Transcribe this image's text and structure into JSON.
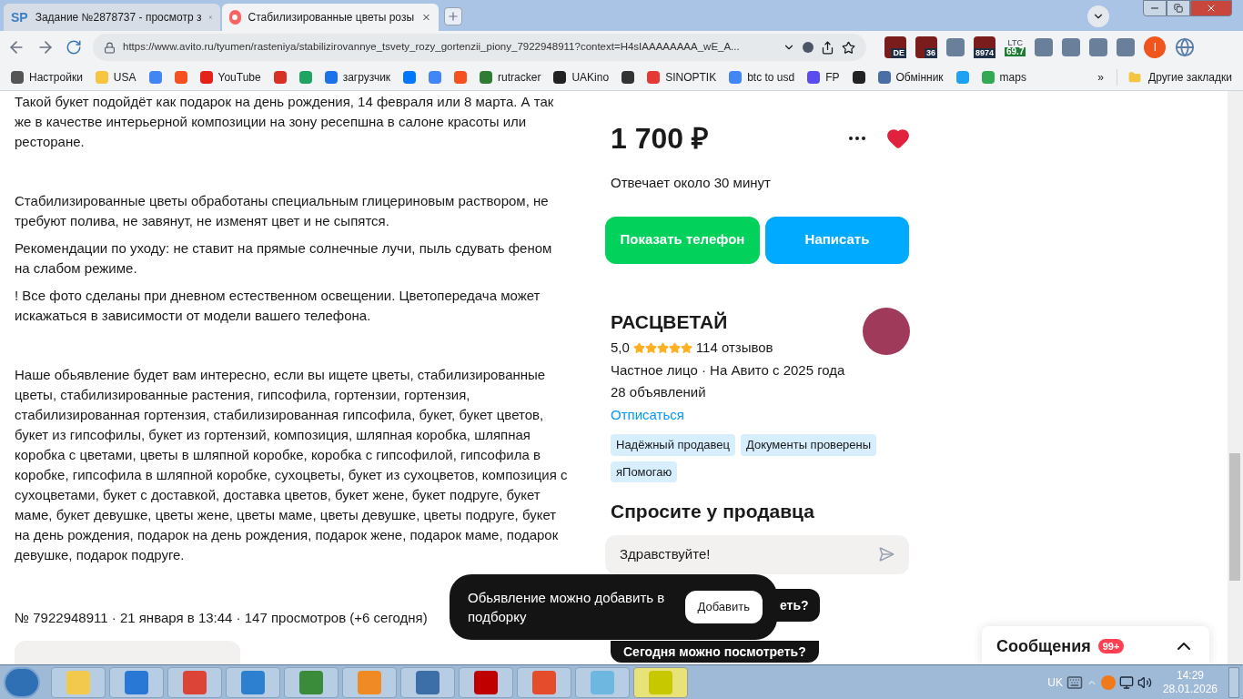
{
  "browser": {
    "tabs": [
      {
        "title": "Задание №2878737 - просмотр з",
        "selected": false,
        "favicon": "SP"
      },
      {
        "title": "Стабилизированные цветы розы",
        "selected": true
      }
    ],
    "url": "https://www.avito.ru/tyumen/rasteniya/stabilizirovannye_tsvety_rozy_gortenzii_piony_7922948911?context=H4sIAAAAAAAA_wE_A...",
    "extensions": [
      {
        "kind": "badge",
        "label": "DE"
      },
      {
        "kind": "badge",
        "label": "36"
      },
      {
        "kind": "plain"
      },
      {
        "kind": "badge",
        "label": "8974"
      },
      {
        "kind": "ticker",
        "top": "LTC",
        "label": "69.7"
      },
      {
        "kind": "plain"
      },
      {
        "kind": "plain"
      },
      {
        "kind": "plain"
      },
      {
        "kind": "plain"
      },
      {
        "kind": "avatar",
        "label": "I"
      }
    ],
    "bookmarks": [
      {
        "kind": "link",
        "label": "Настройки"
      },
      {
        "kind": "link",
        "label": "USA"
      },
      {
        "kind": "icon"
      },
      {
        "kind": "icon"
      },
      {
        "kind": "link",
        "label": "YouTube"
      },
      {
        "kind": "icon"
      },
      {
        "kind": "icon"
      },
      {
        "kind": "link",
        "label": "загрузчик"
      },
      {
        "kind": "icon"
      },
      {
        "kind": "icon"
      },
      {
        "kind": "icon"
      },
      {
        "kind": "link",
        "label": "rutracker"
      },
      {
        "kind": "link",
        "label": "UAKino"
      },
      {
        "kind": "icon"
      },
      {
        "kind": "link",
        "label": "SINOPTIK"
      },
      {
        "kind": "link",
        "label": "btc to usd"
      },
      {
        "kind": "link",
        "label": "FP"
      },
      {
        "kind": "icon"
      },
      {
        "kind": "link",
        "label": "Обмінник"
      },
      {
        "kind": "icon"
      },
      {
        "kind": "link",
        "label": "maps"
      }
    ],
    "more_bookmarks": "»",
    "other_bookmarks": "Другие закладки"
  },
  "description": [
    [
      "Такой букет подойдёт как подарок на день рождения, 14 февраля или 8 марта. А так же в качестве интерьерной композиции на зону ресепшна в салоне красоты или ресторане."
    ],
    [
      "Стабилизированные цветы обработаны специальным глицериновым раствором, не требуют полива, не завянут, не изменят цвет и не сыпятся.",
      "Рекомендации по уходу: не ставит на прямые солнечные лучи, пыль сдувать феном на слабом режиме.",
      "! Все фото сделаны при дневном естественном освещении. Цветопередача может искажаться в зависимости от модели вашего телефона."
    ],
    [
      "Наше обьявление будет вам интересно, если вы ищете цветы, стабилизированные цветы, стабилизированные растения, гипсофила, гортензии, гортензия, стабилизированная гортензия, стабилизированная гипсофила, букет, букет цветов, букет из гипсофилы, букет из гортензий, композиция, шляпная коробка, шляпная коробка с цветами, цветы в шляпной коробке, коробка с гипсофилой, гипсофила в коробке, гипсофила в шляпной коробке, сухоцветы, букет из сухоцветов, композиция с сухоцветами, букет с доставкой, доставка цветов, букет жене, букет подруге, букет маме, букет девушке, цветы жене, цветы маме, цветы девушке, цветы подруге, букет на день рождения, подарок на день рождения, подарок жене, подарок маме, подарок девушке, подарок подруге."
    ]
  ],
  "listing_meta": "№ 7922948911 · 21 января в 13:44 · 147 просмотров (+6 сегодня)",
  "price": "1 700 ₽",
  "favorite": true,
  "response_time": "Отвечает около 30 минут",
  "buttons": {
    "phone": "Показать телефон",
    "write": "Написать"
  },
  "seller": {
    "name": "РАСЦВЕТАЙ",
    "rating": "5,0",
    "stars": 5,
    "reviews": "114 отзывов",
    "type": "Частное лицо · На Авито с 2025 года",
    "listings": "28 объявлений",
    "unsubscribe": "Отписаться",
    "tags": [
      "Надёжный продавец",
      "Документы проверены",
      "яПомогаю"
    ]
  },
  "ask": {
    "title": "Спросите у продавца",
    "value": "Здравствуйте!"
  },
  "quick_questions": [
    "еть?",
    "Сегодня можно посмотреть?"
  ],
  "toast": {
    "text": "Обьявление можно добавить в подборку",
    "button": "Добавить"
  },
  "messages": {
    "title": "Сообщения",
    "badge": "99+",
    "expanded": false
  },
  "taskbar": {
    "language": "UK",
    "time": "14:29",
    "date": "28.01.2026",
    "apps": [
      {
        "selected": false
      },
      {
        "selected": false
      },
      {
        "selected": false
      },
      {
        "selected": false
      },
      {
        "selected": false
      },
      {
        "selected": false
      },
      {
        "selected": false
      },
      {
        "selected": false
      },
      {
        "selected": false
      },
      {
        "selected": false
      },
      {
        "selected": true
      }
    ]
  }
}
